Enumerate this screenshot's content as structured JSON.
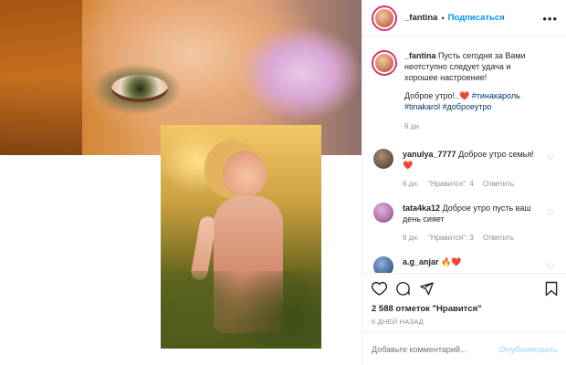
{
  "post": {
    "username": "_fantina",
    "follow_label": "Подписаться",
    "caption": {
      "text": "Пусть сегодня за Вами неотступно следует удача и хорошее настроение!",
      "line2": "Доброе утро!..",
      "emoji": "❤️",
      "tags": [
        "#тинакароль",
        "#tinakarol",
        "#доброеутро"
      ],
      "age": "6 дн."
    },
    "comments": [
      {
        "user": "yanulya_7777",
        "text": "Доброе утро семья!",
        "emoji": "❤️",
        "age": "6 дн.",
        "likes": "\"Нравится\": 4",
        "reply": "Ответить",
        "avatar_color": "#6e5a4b"
      },
      {
        "user": "tata4ka12",
        "text": "Доброе утро пусть ваш день сияет",
        "age": "6 дн.",
        "likes": "\"Нравится\": 3",
        "reply": "Ответить",
        "avatar_color": "#b878ad"
      },
      {
        "user": "a.g_anjar",
        "text": "",
        "emoji": "🔥❤️",
        "avatar_color": "#4a6aa0"
      }
    ],
    "likes_text": "2 588 отметок \"Нравится\"",
    "time_ago": "6 ДНЕЙ НАЗАД",
    "add_comment_placeholder": "Добавьте комментарий...",
    "publish_label": "Опубликовать"
  },
  "icons": {
    "more": "more-icon",
    "like": "heart-icon",
    "comment": "comment-icon",
    "share": "share-icon",
    "save": "bookmark-icon"
  },
  "colors": {
    "accent": "#0095f6",
    "publish_disabled": "#b2dffc",
    "story_ring": "#e1306c"
  }
}
